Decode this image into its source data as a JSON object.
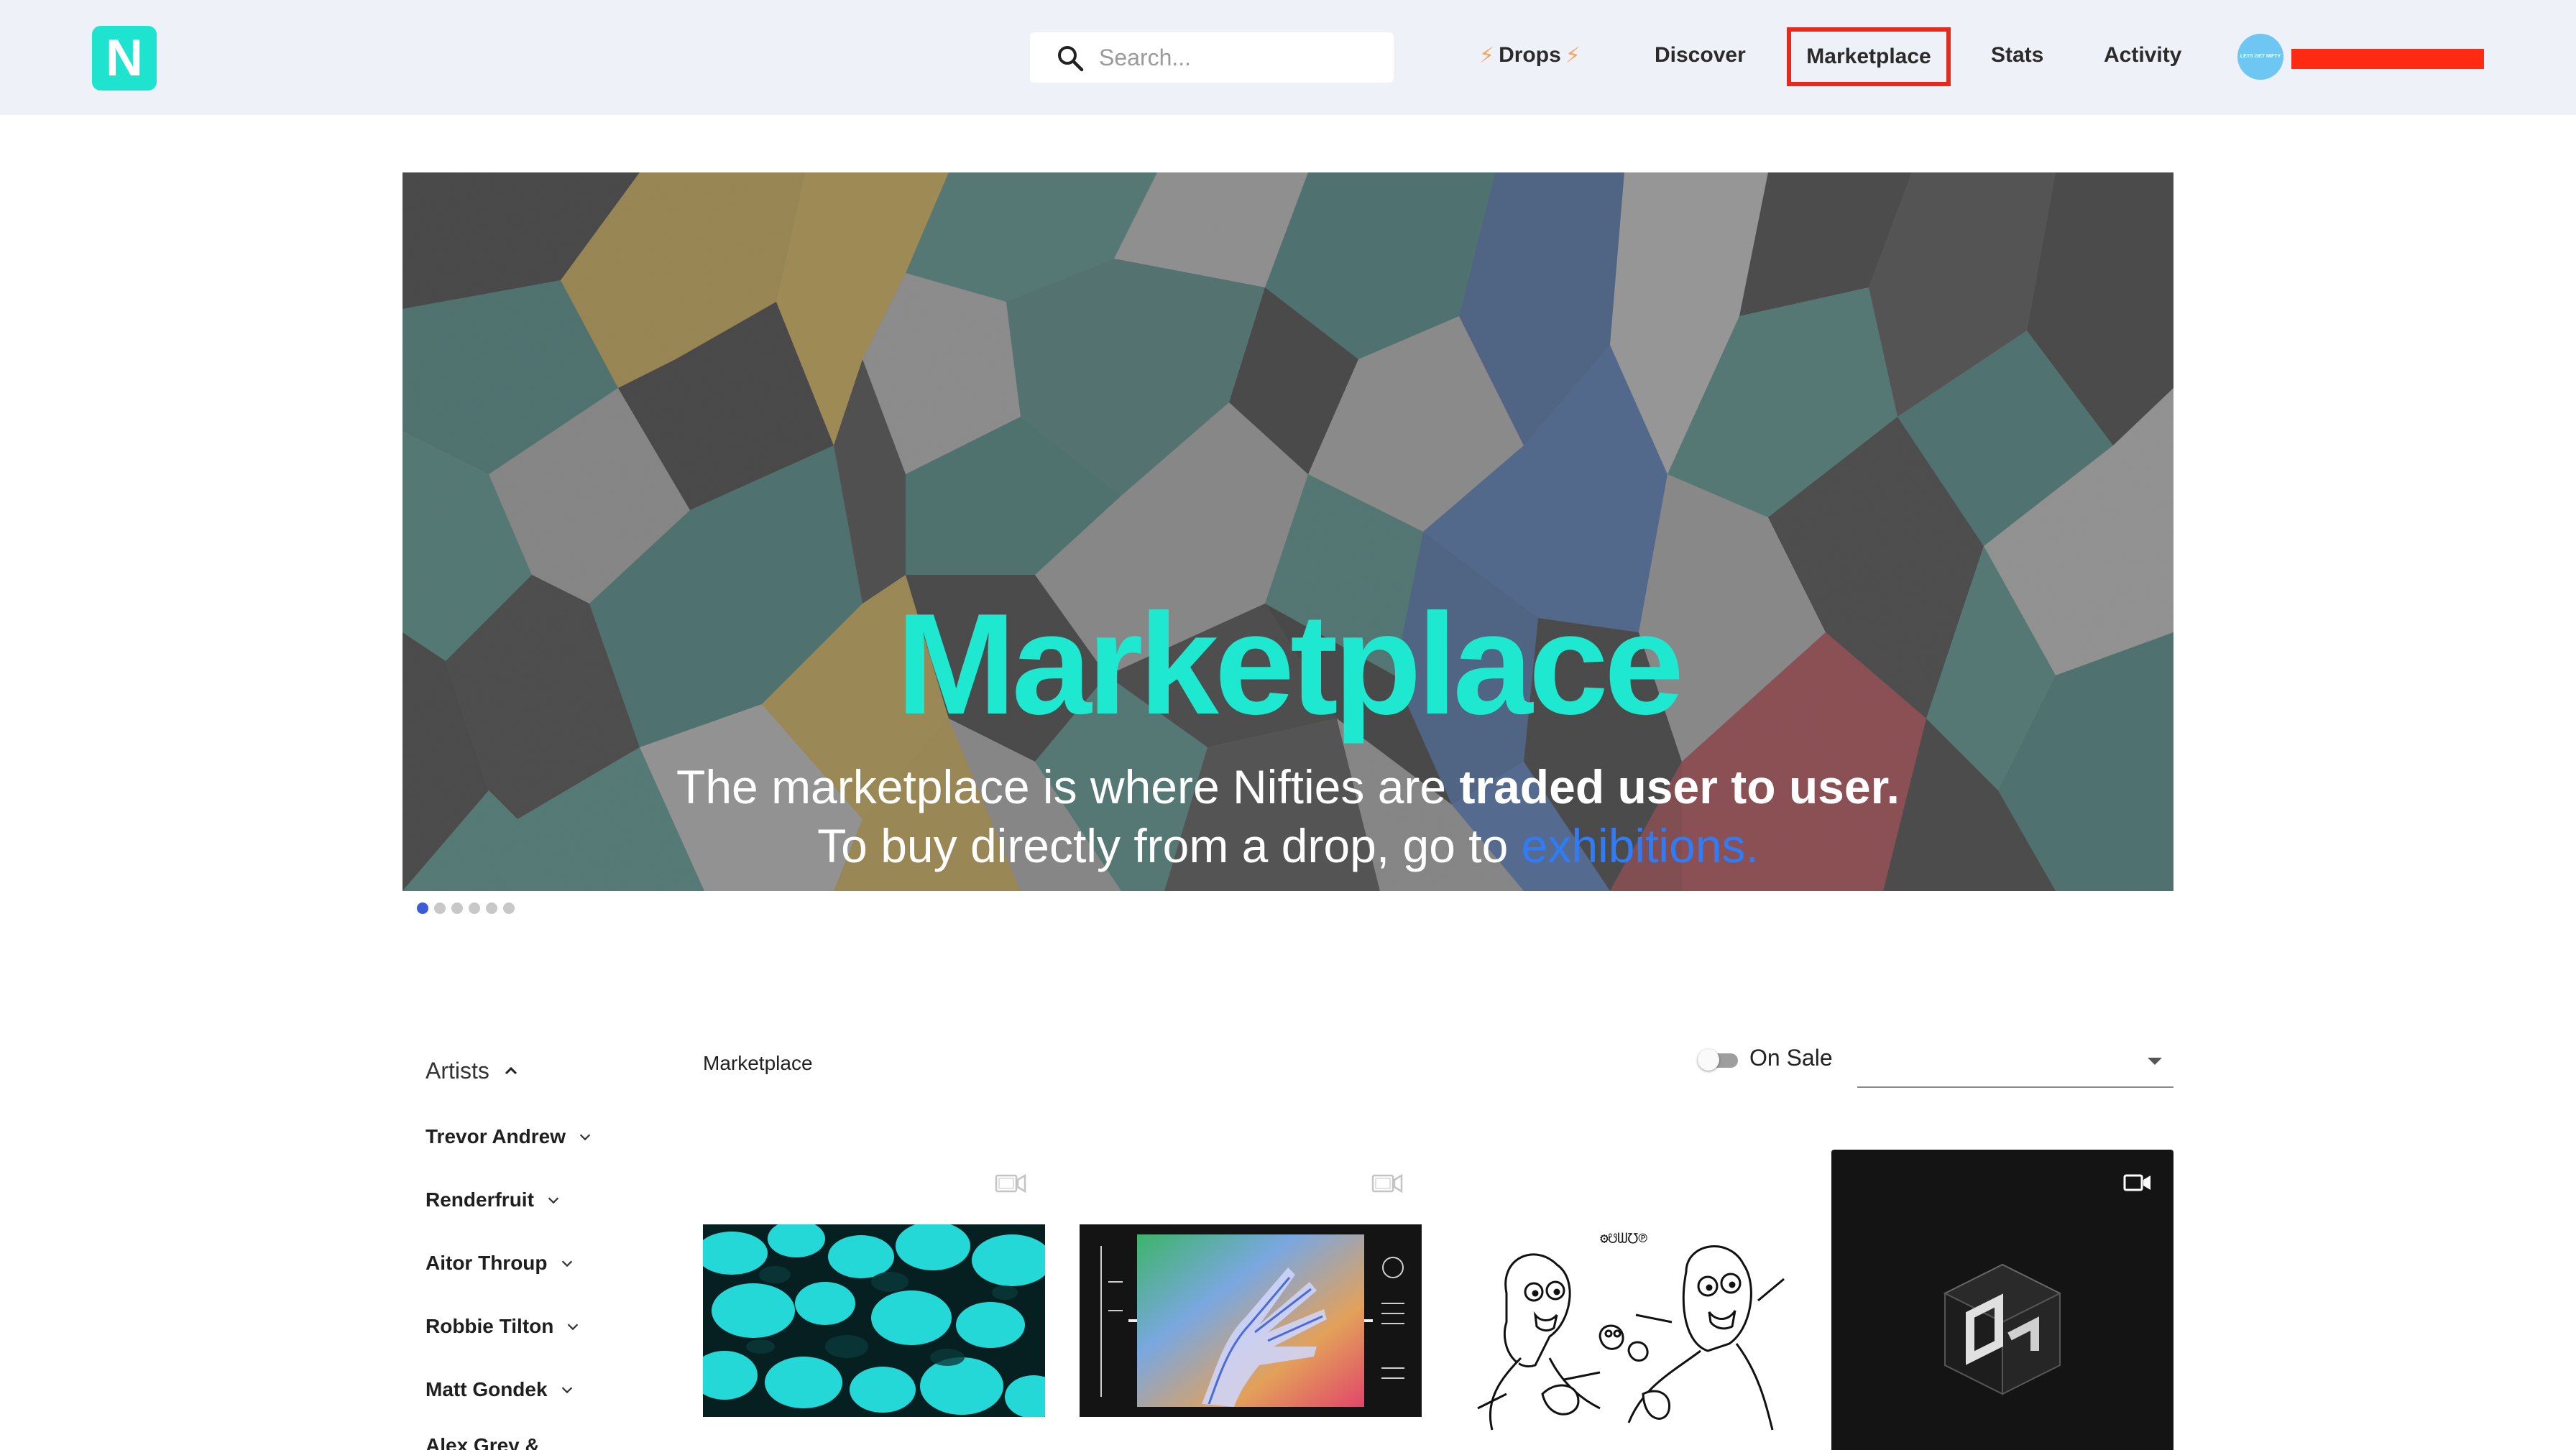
{
  "header": {
    "logo_letter": "N",
    "search_placeholder": "Search...",
    "nav": {
      "drops": "Drops",
      "discover": "Discover",
      "marketplace": "Marketplace",
      "stats": "Stats",
      "activity": "Activity"
    },
    "avatar_text": "LETS GET NIFTY"
  },
  "hero": {
    "title": "Marketplace",
    "line1_plain": "The marketplace is where Nifties are ",
    "line1_bold": "traded user to user.",
    "line2_plain": "To buy directly from a drop, go to ",
    "line2_link": "exhibitions.",
    "carousel_slides": 6,
    "active_slide": 1
  },
  "sidebar": {
    "artists_label": "Artists",
    "artists": [
      "Trevor Andrew",
      "Renderfruit",
      "Aitor Throup",
      "Robbie Tilton",
      "Matt Gondek",
      "Alex Grey &"
    ]
  },
  "listing": {
    "breadcrumb": "Marketplace",
    "on_sale_label": "On Sale",
    "on_sale_enabled": false,
    "sort_value": ""
  },
  "colors": {
    "header_bg": "#eef1f7",
    "brand": "#1ee3cf",
    "highlight": "#e5291d",
    "link": "#2f7cf6"
  }
}
